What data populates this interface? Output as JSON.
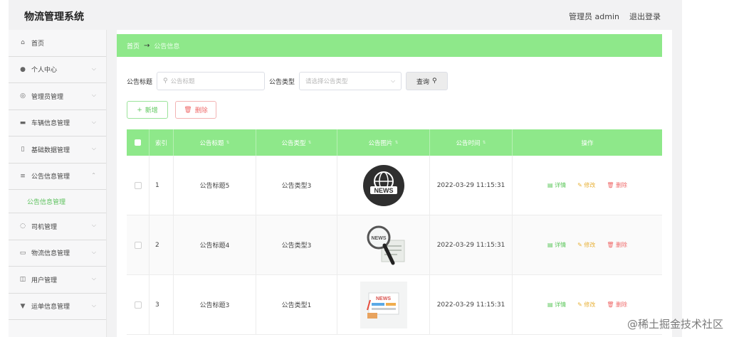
{
  "app": {
    "title": "物流管理系统"
  },
  "header": {
    "user": "管理员 admin",
    "logout": "退出登录"
  },
  "sidebar": {
    "items": [
      {
        "label": "首页",
        "icon": "home-icon",
        "expandable": false
      },
      {
        "label": "个人中心",
        "icon": "user-icon",
        "expandable": true
      },
      {
        "label": "管理员管理",
        "icon": "admin-icon",
        "expandable": true
      },
      {
        "label": "车辆信息管理",
        "icon": "vehicle-icon",
        "expandable": true
      },
      {
        "label": "基础数据管理",
        "icon": "data-icon",
        "expandable": true
      },
      {
        "label": "公告信息管理",
        "icon": "list-icon",
        "expandable": true,
        "expanded": true
      },
      {
        "label": "司机管理",
        "icon": "driver-icon",
        "expandable": true
      },
      {
        "label": "物流信息管理",
        "icon": "logistics-icon",
        "expandable": true
      },
      {
        "label": "用户管理",
        "icon": "users-icon",
        "expandable": true
      },
      {
        "label": "运单信息管理",
        "icon": "waybill-icon",
        "expandable": true
      }
    ],
    "sub_active": "公告信息管理"
  },
  "breadcrumb": {
    "home": "首页",
    "sep": "→",
    "current": "公告信息"
  },
  "search": {
    "title_label": "公告标题",
    "title_placeholder": "公告标题",
    "type_label": "公告类型",
    "type_placeholder": "请选择公告类型",
    "query_button": "查询"
  },
  "actions": {
    "add": "新增",
    "delete": "删除"
  },
  "table": {
    "headers": [
      "索引",
      "公告标题",
      "公告类型",
      "公告图片",
      "公告时间",
      "操作"
    ],
    "rows": [
      {
        "index": "1",
        "title": "公告标题5",
        "type": "公告类型3",
        "image": "news-globe",
        "time": "2022-03-29 11:15:31"
      },
      {
        "index": "2",
        "title": "公告标题4",
        "type": "公告类型3",
        "image": "news-magnifier",
        "time": "2022-03-29 11:15:31"
      },
      {
        "index": "3",
        "title": "公告标题3",
        "type": "公告类型1",
        "image": "news-board",
        "time": "2022-03-29 11:15:31"
      }
    ],
    "ops": {
      "detail": "详情",
      "edit": "修改",
      "delete": "删除"
    }
  },
  "watermark": "@稀土掘金技术社区",
  "colors": {
    "accent": "#8ee88a",
    "accent_text": "#5bc75a",
    "danger": "#ef6a6a",
    "warning": "#e8b23a"
  }
}
